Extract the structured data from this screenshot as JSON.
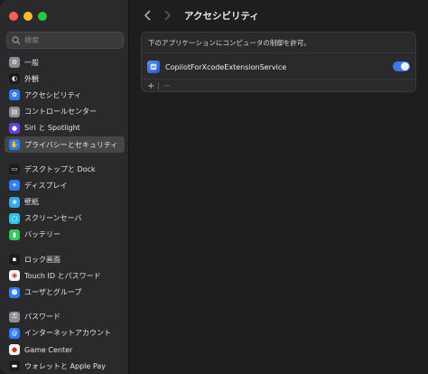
{
  "sidebar": {
    "search_placeholder": "検索",
    "groups": [
      [
        {
          "label": "一般",
          "icon": "gear-icon",
          "color": "#8e8e93"
        },
        {
          "label": "外観",
          "icon": "appearance-icon",
          "color": "#1c1c1e"
        },
        {
          "label": "アクセシビリティ",
          "icon": "accessibility-icon",
          "color": "#2f7cf6"
        },
        {
          "label": "コントロールセンター",
          "icon": "control-center-icon",
          "color": "#8e8e93"
        },
        {
          "label": "Siri と Spotlight",
          "icon": "siri-icon",
          "color": "#6b3fd6"
        },
        {
          "label": "プライバシーとセキュリティ",
          "icon": "privacy-hand-icon",
          "color": "#2f7cf6"
        }
      ],
      [
        {
          "label": "デスクトップと Dock",
          "icon": "dock-icon",
          "color": "#1c1c1e"
        },
        {
          "label": "ディスプレイ",
          "icon": "display-icon",
          "color": "#2f7cf6"
        },
        {
          "label": "壁紙",
          "icon": "wallpaper-icon",
          "color": "#35a8e6"
        },
        {
          "label": "スクリーンセーバ",
          "icon": "screensaver-icon",
          "color": "#35c0e6"
        },
        {
          "label": "バッテリー",
          "icon": "battery-icon",
          "color": "#34c759"
        }
      ],
      [
        {
          "label": "ロック画面",
          "icon": "lock-icon",
          "color": "#1c1c1e"
        },
        {
          "label": "Touch ID とパスワード",
          "icon": "fingerprint-icon",
          "color": "#f2f2f2"
        },
        {
          "label": "ユーザとグループ",
          "icon": "users-icon",
          "color": "#2f7cf6"
        }
      ],
      [
        {
          "label": "パスワード",
          "icon": "key-icon",
          "color": "#8e8e93"
        },
        {
          "label": "インターネットアカウント",
          "icon": "at-icon",
          "color": "#2f7cf6"
        },
        {
          "label": "Game Center",
          "icon": "game-center-icon",
          "color": "#f2f2f2"
        },
        {
          "label": "ウォレットと Apple Pay",
          "icon": "wallet-icon",
          "color": "#1c1c1e"
        }
      ]
    ],
    "selected": "プライバシーとセキュリティ"
  },
  "toolbar": {
    "title": "アクセシビリティ"
  },
  "panel": {
    "description": "下のアプリケーションにコンピュータの制御を許可。",
    "apps": [
      {
        "name": "CopilotForXcodeExtensionService",
        "enabled": true
      }
    ],
    "add_label": "+",
    "remove_label": "−"
  }
}
